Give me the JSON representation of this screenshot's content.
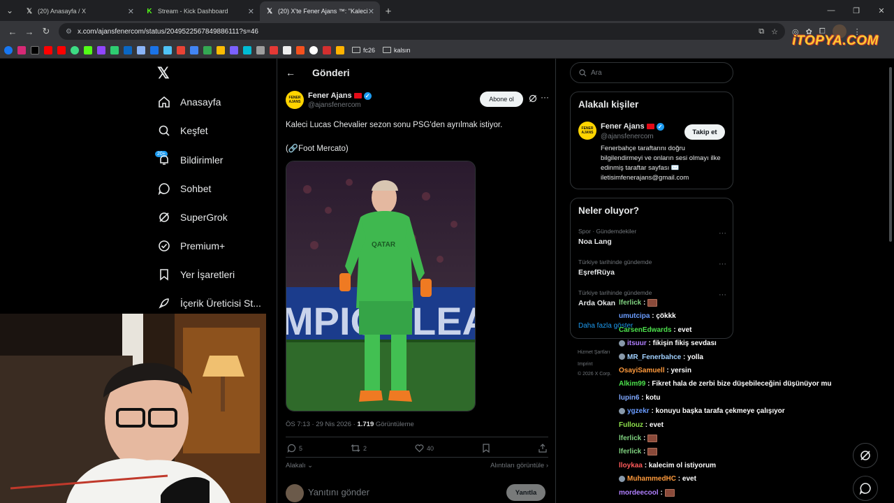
{
  "browser": {
    "tabs": [
      {
        "title": "(20) Anasayfa / X",
        "favicon": "X",
        "active": false
      },
      {
        "title": "Stream - Kick Dashboard",
        "favicon": "K",
        "active": false
      },
      {
        "title": "(20) X'te Fener Ajans ™: \"Kaleci",
        "favicon": "X",
        "active": true
      }
    ],
    "url": "x.com/ajansfenercom/status/2049522567849886111?s=46",
    "bookmark_folders": [
      "fc26",
      "kalsın"
    ],
    "watermark": "iTOPYA.COM"
  },
  "x_nav": {
    "items": [
      {
        "label": "Anasayfa",
        "icon": "home-icon"
      },
      {
        "label": "Keşfet",
        "icon": "search-icon"
      },
      {
        "label": "Bildirimler",
        "icon": "bell-icon"
      },
      {
        "label": "Sohbet",
        "icon": "chat-icon"
      },
      {
        "label": "SuperGrok",
        "icon": "grok-icon"
      },
      {
        "label": "Premium+",
        "icon": "premium-icon"
      },
      {
        "label": "Yer İşaretleri",
        "icon": "bookmark-icon"
      },
      {
        "label": "İçerik Üreticisi St...",
        "icon": "rocket-icon"
      }
    ],
    "notif_badge": "20+"
  },
  "post": {
    "header": "Gönderi",
    "author_name": "Fener Ajans",
    "author_handle": "@ajansfenercom",
    "avatar_text": "FENER AJANS",
    "subscribe_label": "Abone ol",
    "text": "Kaleci Lucas Chevalier sezon sonu PSG'den ayrılmak istiyor.",
    "source": "(🔗Foot Mercato)",
    "time": "ÖS 7:13 · 29 Nis 2026 · ",
    "views": "1.719",
    "views_label": " Görüntüleme",
    "replies": "5",
    "reposts": "2",
    "likes": "40",
    "related_label": "Alakalı",
    "quotes_label": "Alıntıları görüntüle",
    "reply_placeholder": "Yanıtını gönder",
    "reply_button": "Yanıtla"
  },
  "right": {
    "search_placeholder": "Ara",
    "related_title": "Alakalı kişiler",
    "related_person": {
      "name": "Fener Ajans",
      "handle": "@ajansfenercom",
      "follow_label": "Takip et",
      "bio": "Fenerbahçe taraftarını doğru bilgilendirmeyi ve onların sesi olmayı ilke edinmiş taraftar sayfası ✉️ iletisimfenerajans@gmail.com"
    },
    "trends_title": "Neler oluyor?",
    "trends": [
      {
        "category": "Spor · Gündemdekiler",
        "name": "Noa Lang"
      },
      {
        "category": "Türkiye tarihinde gündemde",
        "name": "EşrefRüya"
      },
      {
        "category": "Türkiye tarihinde gündemde",
        "name": "Arda Okan"
      }
    ],
    "show_more": "Daha fazla göster",
    "footer": [
      "Hizmet Şartları",
      "Imprint",
      "© 2026 X Corp."
    ]
  },
  "chat": [
    {
      "user": "lferlick",
      "color": "#7fd17f",
      "msg": "",
      "emote": true,
      "badge": false
    },
    {
      "user": "umutcipa",
      "color": "#6a9cff",
      "msg": "çökkk",
      "emote": false,
      "badge": false
    },
    {
      "user": "CarsenEdwards",
      "color": "#4ce04c",
      "msg": "evet",
      "emote": false,
      "badge": false
    },
    {
      "user": "itsuur",
      "color": "#b07fff",
      "msg": "fikişin fikiş sevdası",
      "emote": false,
      "badge": true
    },
    {
      "user": "MR_Fenerbahce",
      "color": "#a0d0ff",
      "msg": "yolla",
      "emote": false,
      "badge": true
    },
    {
      "user": "OsayiSamuell",
      "color": "#ff9a3c",
      "msg": "yersin",
      "emote": false,
      "badge": false
    },
    {
      "user": "Alkim99",
      "color": "#4ce04c",
      "msg": "Fikret hala de zerbi bize düşebileceğini düşünüyor mu",
      "emote": false,
      "badge": false
    },
    {
      "user": "lupin6",
      "color": "#7fa8ff",
      "msg": "kotu",
      "emote": false,
      "badge": false
    },
    {
      "user": "ygzekr",
      "color": "#6a9cff",
      "msg": "konuyu başka tarafa çekmeye çalışıyor",
      "emote": false,
      "badge": true
    },
    {
      "user": "Fullouz",
      "color": "#8ee04c",
      "msg": "evet",
      "emote": false,
      "badge": false
    },
    {
      "user": "lferlick",
      "color": "#7fd17f",
      "msg": "",
      "emote": true,
      "badge": false
    },
    {
      "user": "lferlick",
      "color": "#7fd17f",
      "msg": "",
      "emote": true,
      "badge": false
    },
    {
      "user": "lloykaa",
      "color": "#ff5a5a",
      "msg": "kalecim ol istiyorum",
      "emote": false,
      "badge": false
    },
    {
      "user": "MuhammedHC",
      "color": "#ff9a3c",
      "msg": "evet",
      "emote": false,
      "badge": true
    },
    {
      "user": "mordeecool",
      "color": "#b07fff",
      "msg": "",
      "emote": true,
      "badge": false
    }
  ]
}
